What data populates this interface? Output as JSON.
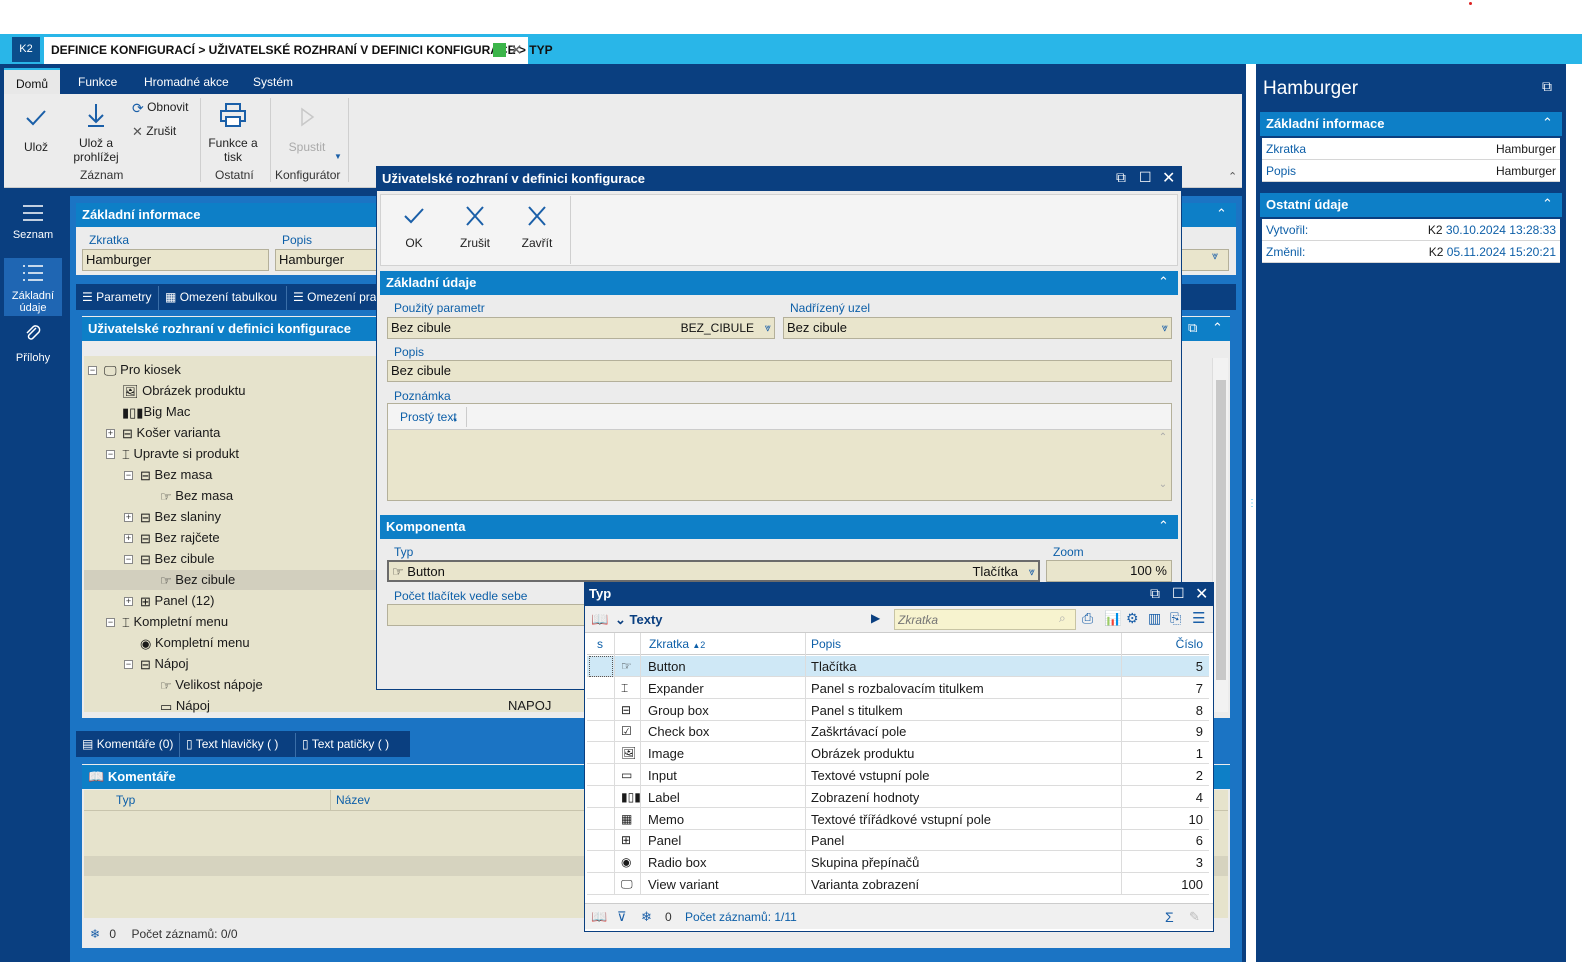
{
  "app": {
    "logo": "K2",
    "doc_tab": "DEFINICE KONFIGURACÍ > UŽIVATELSKÉ ROZHRANÍ V DEFINICI KONFIGURACE > TYP"
  },
  "ribbon": {
    "tabs": [
      "Domů",
      "Funkce",
      "Hromadné akce",
      "Systém"
    ],
    "buttons": {
      "uloz": "Ulož",
      "uloz_prohlizej": "Ulož a prohlížej",
      "obnovit": "Obnovit",
      "zrusit": "Zrušit",
      "funkce_tisk": "Funkce a tisk",
      "spustit": "Spustit"
    },
    "groups": [
      "Záznam",
      "Ostatní",
      "Konfigurátor"
    ]
  },
  "leftnav": {
    "items": [
      "Seznam",
      "Základní údaje",
      "Přílohy"
    ]
  },
  "main": {
    "basic_title": "Základní informace",
    "zkratka_label": "Zkratka",
    "zkratka_value": "Hamburger",
    "popis_label": "Popis",
    "popis_value": "Hamburger",
    "tabs": [
      "Parametry",
      "Omezení tabulkou",
      "Omezení pra"
    ],
    "ui_title": "Uživatelské rozhraní v definici konfigurace",
    "tree": [
      "Pro kiosek",
      "Obrázek produktu",
      "Big Mac",
      "Košer varianta",
      "Upravte si produkt",
      "Bez masa",
      "Bez masa",
      "Bez slaniny",
      "Bez rajčete",
      "Bez cibule",
      "Bez cibule",
      "Panel (12)",
      "Kompletní menu",
      "Kompletní menu",
      "Nápoj",
      "Velikost nápoje",
      "Nápoj"
    ],
    "napoj_code": "NAPOJ",
    "bottom_tabs": [
      "Komentáře (0)",
      "Text hlavičky ( )",
      "Text patičky ( )"
    ],
    "comments_title": "Komentáře",
    "comments_cols": [
      "Typ",
      "Název"
    ],
    "status_count": "0",
    "status_records": "Počet záznamů: 0/0"
  },
  "modal": {
    "title": "Uživatelské rozhraní v definici konfigurace",
    "buttons": [
      "OK",
      "Zrušit",
      "Zavřít"
    ],
    "sec1": "Základní údaje",
    "param_label": "Použitý parametr",
    "param_value": "Bez cibule",
    "param_code": "BEZ_CIBULE",
    "parent_label": "Nadřízený uzel",
    "parent_value": "Bez cibule",
    "popis_label": "Popis",
    "popis_value": "Bez cibule",
    "note_label": "Poznámka",
    "note_format": "Prostý text",
    "sec2": "Komponenta",
    "typ_label": "Typ",
    "typ_value": "Button",
    "typ_desc": "Tlačítka",
    "zoom_label": "Zoom",
    "zoom_value": "100 %",
    "count_label": "Počet tlačítek vedle sebe"
  },
  "right": {
    "title": "Hamburger",
    "sec1": "Základní informace",
    "zkratka_label": "Zkratka",
    "zkratka_value": "Hamburger",
    "popis_label": "Popis",
    "popis_value": "Hamburger",
    "sec2": "Ostatní údaje",
    "created_label": "Vytvořil:",
    "created_user": "K2",
    "created_date": "30.10.2024 13:28:33",
    "changed_label": "Změnil:",
    "changed_user": "K2",
    "changed_date": "05.11.2024 15:20:21"
  },
  "popup": {
    "title": "Typ",
    "view": "Texty",
    "search_placeholder": "Zkratka",
    "cols": {
      "s": "s",
      "zkratka": "Zkratka",
      "sort": "2",
      "popis": "Popis",
      "cislo": "Číslo"
    },
    "rows": [
      {
        "zkratka": "Button",
        "popis": "Tlačítka",
        "cislo": "5"
      },
      {
        "zkratka": "Expander",
        "popis": "Panel s rozbalovacím titulkem",
        "cislo": "7"
      },
      {
        "zkratka": "Group box",
        "popis": "Panel s titulkem",
        "cislo": "8"
      },
      {
        "zkratka": "Check box",
        "popis": "Zaškrtávací pole",
        "cislo": "9"
      },
      {
        "zkratka": "Image",
        "popis": "Obrázek produktu",
        "cislo": "1"
      },
      {
        "zkratka": "Input",
        "popis": "Textové vstupní pole",
        "cislo": "2"
      },
      {
        "zkratka": "Label",
        "popis": "Zobrazení hodnoty",
        "cislo": "4"
      },
      {
        "zkratka": "Memo",
        "popis": "Textové třířádkové vstupní pole",
        "cislo": "10"
      },
      {
        "zkratka": "Panel",
        "popis": "Panel",
        "cislo": "6"
      },
      {
        "zkratka": "Radio box",
        "popis": "Skupina přepínačů",
        "cislo": "3"
      },
      {
        "zkratka": "View variant",
        "popis": "Varianta zobrazení",
        "cislo": "100"
      }
    ],
    "status_count": "0",
    "status_records": "Počet záznamů: 1/11"
  },
  "colors": {
    "dark": "#0a3f80",
    "accent": "#29b6e8",
    "section": "#0d7fc7",
    "field": "#e9e5cc"
  }
}
